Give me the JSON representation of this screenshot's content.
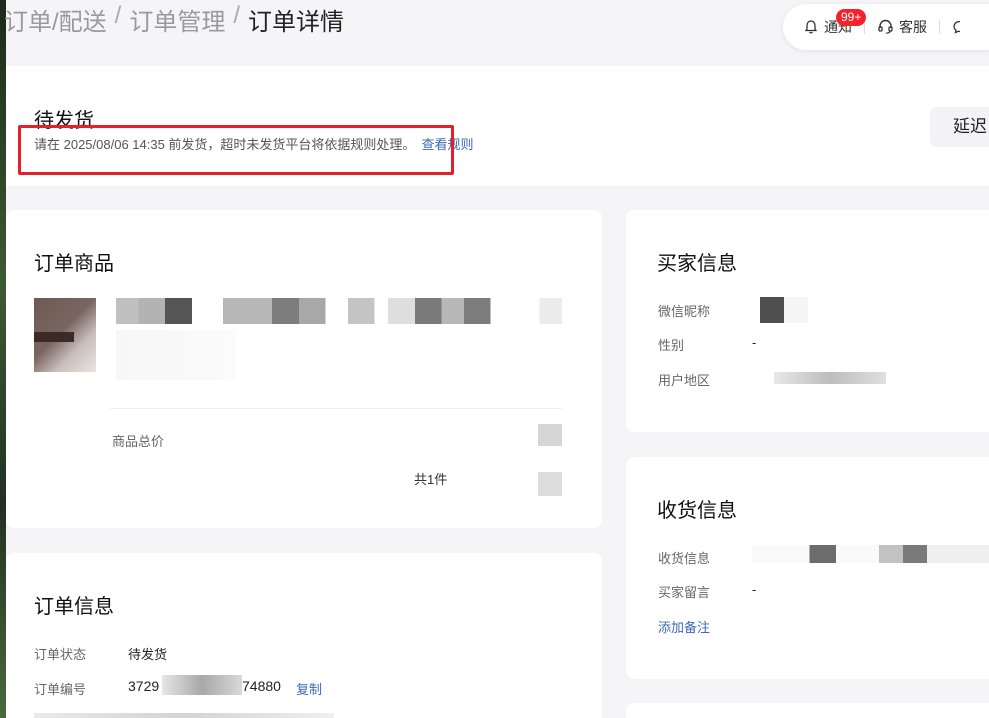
{
  "breadcrumb": {
    "level1": "订单/配送",
    "level2": "订单管理",
    "current": "订单详情",
    "separator": "/"
  },
  "header_actions": {
    "notify_label": "通知",
    "notify_badge": "99+",
    "service_label": "客服"
  },
  "status": {
    "title": "待发货",
    "description": "请在 2025/08/06 14:35 前发货，超时未发货平台将依据规则处理。",
    "rule_link": "查看规则",
    "delay_button": "延迟"
  },
  "order_goods": {
    "title": "订单商品",
    "total_price_label": "商品总价",
    "count_text": "共1件"
  },
  "buyer_info": {
    "title": "买家信息",
    "wechat_label": "微信昵称",
    "gender_label": "性别",
    "gender_value": "-",
    "region_label": "用户地区"
  },
  "shipping_info": {
    "title": "收货信息",
    "address_label": "收货信息",
    "message_label": "买家留言",
    "message_value": "-",
    "add_remark": "添加备注"
  },
  "order_info": {
    "title": "订单信息",
    "status_label": "订单状态",
    "status_value": "待发货",
    "number_label": "订单编号",
    "number_prefix": "3729",
    "number_suffix": "74880",
    "copy_link": "复制"
  }
}
